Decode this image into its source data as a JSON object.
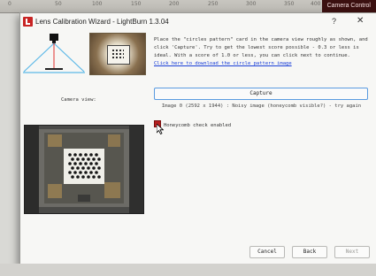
{
  "ruler": {
    "ticks": [
      "0",
      "50",
      "100",
      "150",
      "200",
      "250",
      "300",
      "350",
      "400"
    ]
  },
  "camera_control": {
    "label": "Camera Control"
  },
  "dialog": {
    "title": "Lens Calibration Wizard - LightBurn 1.3.04",
    "help_label": "?",
    "close_label": "✕",
    "instructions": "Place the \"circles pattern\" card in the camera view roughly as shown, and click 'Capture'. Try to get the lowest score possible - 0.3 or less is ideal.  With a score of 1.0 or less, you can click next to continue.",
    "download_link": "Click here to download the circle pattern image",
    "camera_view_label": "Camera view:",
    "capture_label": "Capture",
    "status": "Image 0 (2592 x 1944) : Noisy image (honeycomb visible?) - try again",
    "honeycomb_label": "Honeycomb check enabled",
    "honeycomb_checked": true,
    "buttons": {
      "cancel": "Cancel",
      "back": "Back",
      "next": "Next"
    }
  },
  "colors": {
    "accent": "#5a9be0",
    "link": "#1a3fd8",
    "app_icon": "#c82424"
  },
  "icons": {
    "app": "lightburn-logo-icon",
    "cursor": "mouse-pointer-icon"
  }
}
